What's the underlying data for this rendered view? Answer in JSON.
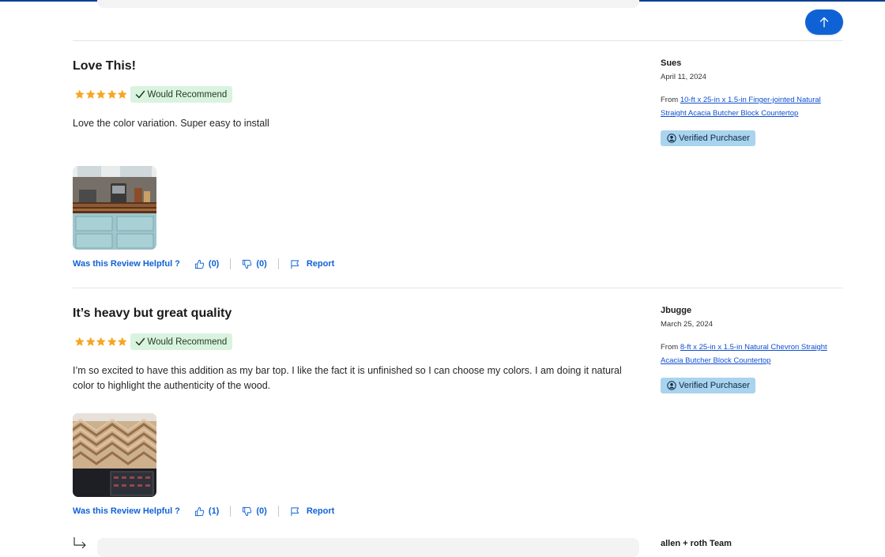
{
  "page": {
    "colors": {
      "accent": "#0f62d6",
      "recommend_bg": "#d9f3df",
      "verified_bg": "#a9d3ee",
      "star": "#f5a623"
    }
  },
  "back_to_top": {
    "icon": "arrow-up-icon"
  },
  "reviews": [
    {
      "title": "Love This!",
      "rating": 5,
      "recommend_label": "Would Recommend",
      "body": "Love the color variation. Super easy to install",
      "photo": "countertop-kitchen-photo",
      "helpful_label": "Was this Review Helpful ?",
      "upvotes": "(0)",
      "downvotes": "(0)",
      "report_label": "Report",
      "author": "Sues",
      "date": "April 11, 2024",
      "from_prefix": "From",
      "product_link": "10-ft x 25-in x 1.5-in Finger-jointed Natural Straight Acacia Butcher Block Countertop",
      "verified_label": "Verified Purchaser"
    },
    {
      "title": "It’s heavy but great quality",
      "rating": 5,
      "recommend_label": "Would Recommend",
      "body": "I’m so excited to have this addition as my bar top. I like the fact it is unfinished so I can choose my colors. I am doing it natural color to highlight the authenticity of the wood.",
      "photo": "chevron-bar-top-photo",
      "helpful_label": "Was this Review Helpful ?",
      "upvotes": "(1)",
      "downvotes": "(0)",
      "report_label": "Report",
      "author": "Jbugge",
      "date": "March 25, 2024",
      "from_prefix": "From",
      "product_link": "8-ft x 25-in x 1.5-in Natural Chevron Straight Acacia Butcher Block Countertop",
      "verified_label": "Verified Purchaser"
    }
  ],
  "reply": {
    "author": "allen + roth Team",
    "icon": "reply-arrow-icon"
  }
}
